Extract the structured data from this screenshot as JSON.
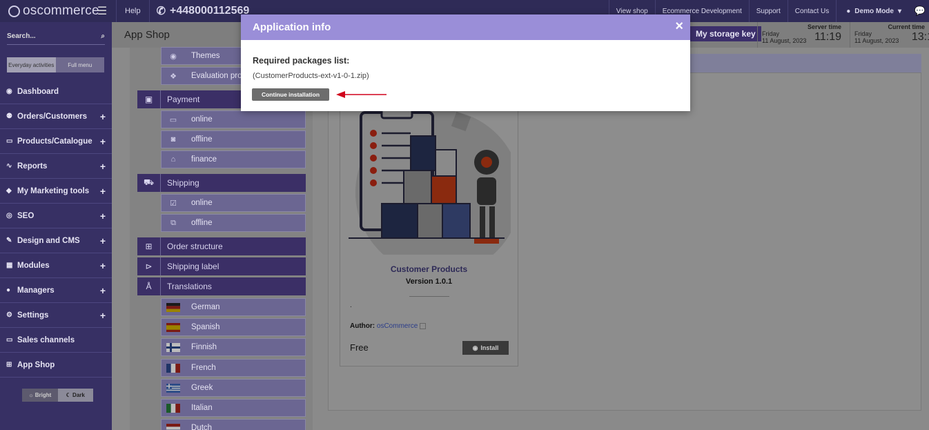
{
  "topbar": {
    "logo_text": "oscommerce",
    "help_label": "Help",
    "phone": "+448000112569",
    "links": [
      "View shop",
      "Ecommerce Development",
      "Support",
      "Contact Us"
    ],
    "user_label": "Demo Mode"
  },
  "sidebar": {
    "search_placeholder": "Search...",
    "menu_toggle": [
      "Everyday activities",
      "Full menu"
    ],
    "items": [
      {
        "label": "Dashboard",
        "icon": "dashboard-icon",
        "expandable": false
      },
      {
        "label": "Orders/Customers",
        "icon": "users-icon",
        "expandable": true
      },
      {
        "label": "Products/Catalogue",
        "icon": "folder-icon",
        "expandable": true
      },
      {
        "label": "Reports",
        "icon": "chart-icon",
        "expandable": true
      },
      {
        "label": "My Marketing tools",
        "icon": "tag-icon",
        "expandable": true
      },
      {
        "label": "SEO",
        "icon": "globe-icon",
        "expandable": true
      },
      {
        "label": "Design and CMS",
        "icon": "brush-icon",
        "expandable": true
      },
      {
        "label": "Modules",
        "icon": "modules-icon",
        "expandable": true
      },
      {
        "label": "Managers",
        "icon": "user-icon",
        "expandable": true
      },
      {
        "label": "Settings",
        "icon": "cogs-icon",
        "expandable": true
      },
      {
        "label": "Sales channels",
        "icon": "monitor-icon",
        "expandable": false
      },
      {
        "label": "App Shop",
        "icon": "cart-icon",
        "expandable": false
      }
    ],
    "theme": [
      "Bright",
      "Dark"
    ]
  },
  "header": {
    "title": "App Shop",
    "storage_key_label": "My storage key",
    "server_time": {
      "label": "Server time",
      "day": "Friday",
      "date": "11 August, 2023",
      "time": "11:19"
    },
    "current_time": {
      "label": "Current time",
      "day": "Friday",
      "date": "11 August, 2023",
      "time": "13:1"
    }
  },
  "categories": {
    "themes": "Themes",
    "evaluation": "Evaluation pro",
    "payment": "Payment",
    "payment_online": "online",
    "payment_offline": "offline",
    "payment_finance": "finance",
    "shipping": "Shipping",
    "shipping_online": "online",
    "shipping_offline": "offline",
    "order_structure": "Order structure",
    "shipping_label": "Shipping label",
    "translations": "Translations",
    "languages": [
      "German",
      "Spanish",
      "Finnish",
      "French",
      "Greek",
      "Italian",
      "Dutch"
    ]
  },
  "card": {
    "title": "Customer Products",
    "version": "Version 1.0.1",
    "description": ".",
    "author_label": "Author:",
    "author_name": "osCommerce",
    "price": "Free",
    "install_label": "Install"
  },
  "modal": {
    "title": "Application info",
    "close": "×",
    "required_label": "Required packages list:",
    "package": "(CustomerProducts-ext-v1-0-1.zip)",
    "continue_label": "Continue installation"
  },
  "colors": {
    "modal_header": "#9a8ed8",
    "sidebar": "#373064",
    "annotation_arrow": "#d0021b"
  }
}
